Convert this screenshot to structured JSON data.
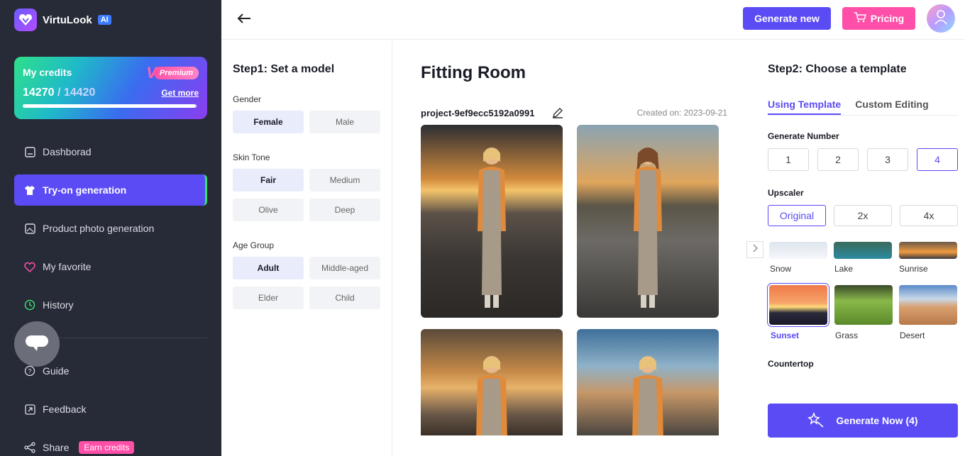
{
  "brand": {
    "name": "VirtuLook",
    "badge": "AI"
  },
  "credits": {
    "title": "My credits",
    "premium": "Premium",
    "used": "14270",
    "separator": " / ",
    "total": "14420",
    "get_more": "Get more",
    "progress": 0.99
  },
  "nav": {
    "dashboard": "Dashborad",
    "tryon": "Try-on generation",
    "product": "Product photo generation",
    "favorite": "My favorite",
    "history": "History",
    "guide": "Guide",
    "feedback": "Feedback",
    "share": "Share",
    "earn": "Earn credits"
  },
  "topbar": {
    "generate_new": "Generate new",
    "pricing": "Pricing"
  },
  "step1": {
    "title": "Step1: Set a model",
    "gender_label": "Gender",
    "gender": [
      "Female",
      "Male"
    ],
    "skin_label": "Skin Tone",
    "skin": [
      "Fair",
      "Medium",
      "Olive",
      "Deep"
    ],
    "age_label": "Age Group",
    "age": [
      "Adult",
      "Middle-aged",
      "Elder",
      "Child"
    ]
  },
  "center": {
    "title": "Fitting Room",
    "project": "project-9ef9ecc5192a0991",
    "created": "Created on:  2023-09-21"
  },
  "step2": {
    "title": "Step2: Choose a template",
    "tabs": [
      "Using Template",
      "Custom Editing"
    ],
    "gen_number_label": "Generate Number",
    "gen_numbers": [
      "1",
      "2",
      "3",
      "4"
    ],
    "upscaler_label": "Upscaler",
    "upscaler": [
      "Original",
      "2x",
      "4x"
    ],
    "templates": [
      "Snow",
      "Lake",
      "Sunrise",
      "Sunset",
      "Grass",
      "Desert"
    ],
    "countertop_label": "Countertop",
    "generate_now": "Generate Now (4)"
  }
}
